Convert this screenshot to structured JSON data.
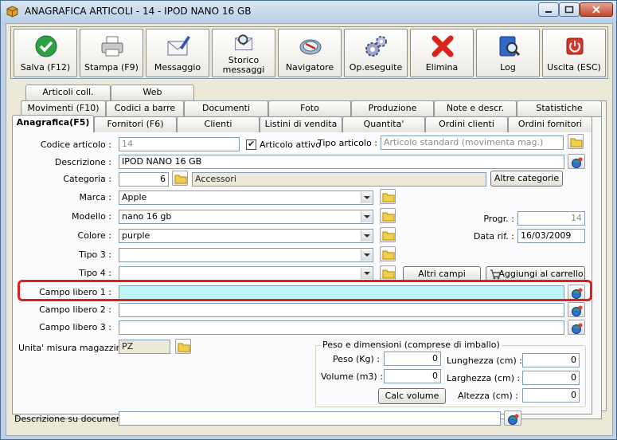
{
  "window": {
    "title": "ANAGRAFICA ARTICOLI - 14 - IPOD NANO 16 GB"
  },
  "toolbar": {
    "save": "Salva (F12)",
    "print": "Stampa (F9)",
    "message": "Messaggio",
    "history_l1": "Storico",
    "history_l2": "messaggi",
    "navigator": "Navigatore",
    "ops": "Op.eseguite",
    "delete": "Elimina",
    "log": "Log",
    "exit": "Uscita (ESC)"
  },
  "tabs": {
    "row3": [
      "Articoli coll.",
      "Web"
    ],
    "row2": [
      "Movimenti (F10)",
      "Codici a barre",
      "Documenti",
      "Foto",
      "Produzione",
      "Note e descr.",
      "Statistiche"
    ],
    "row1": [
      "Anagrafica(F5)",
      "Fornitori (F6)",
      "Clienti",
      "Listini di vendita",
      "Quantita'",
      "Ordini clienti",
      "Ordini fornitori"
    ]
  },
  "form": {
    "codice_label": "Codice articolo :",
    "codice_value": "14",
    "attivo_label": "Articolo attivo",
    "tipo_articolo_label": "Tipo articolo :",
    "tipo_articolo_value": "Articolo standard (movimenta mag.)",
    "descrizione_label": "Descrizione :",
    "descrizione_value": "IPOD NANO 16 GB",
    "categoria_label": "Categoria :",
    "categoria_code": "6",
    "categoria_name": "Accessori",
    "altre_categorie": "Altre categorie",
    "marca_label": "Marca :",
    "marca_value": "Apple",
    "modello_label": "Modello :",
    "modello_value": "nano 16 gb",
    "colore_label": "Colore :",
    "colore_value": "purple",
    "tipo3_label": "Tipo 3 :",
    "tipo3_value": "",
    "tipo4_label": "Tipo 4 :",
    "tipo4_value": "",
    "progr_label": "Progr. :",
    "progr_value": "14",
    "data_rif_label": "Data rif. :",
    "data_rif_value": "16/03/2009",
    "altri_campi": "Altri campi",
    "aggiungi_carrello": "Aggiungi al carrello",
    "campo1_label": "Campo libero 1 :",
    "campo1_value": "",
    "campo2_label": "Campo libero 2 :",
    "campo2_value": "",
    "campo3_label": "Campo libero 3 :",
    "campo3_value": "",
    "um_label": "Unita' misura magazzino :",
    "um_value": "PZ",
    "peso_group": "Peso e dimensioni (comprese di imballo)",
    "peso_label": "Peso (Kg) :",
    "peso_value": "0",
    "volume_label": "Volume (m3) :",
    "volume_value": "0",
    "lunghezza_label": "Lunghezza (cm) :",
    "lunghezza_value": "0",
    "larghezza_label": "Larghezza (cm) :",
    "larghezza_value": "0",
    "altezza_label": "Altezza (cm) :",
    "altezza_value": "0",
    "calc_volume": "Calc volume",
    "desc_doc_label": "Descrizione su documenti :",
    "desc_doc_value": ""
  }
}
